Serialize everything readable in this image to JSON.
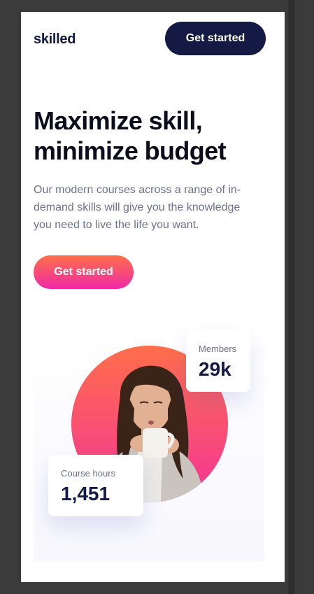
{
  "header": {
    "logo": "skilled",
    "nav_button_label": "Get started"
  },
  "hero": {
    "title": "Maximize skill, minimize budget",
    "description": "Our modern courses across a range of in-demand skills will give you the knowledge you need to live the life you want.",
    "cta_label": "Get started"
  },
  "stats": {
    "members": {
      "label": "Members",
      "value": "29k"
    },
    "course_hours": {
      "label": "Course hours",
      "value": "1,451"
    }
  },
  "colors": {
    "navy": "#141a44",
    "gradient_start": "#ff6f48",
    "gradient_end": "#f02aa6",
    "text_muted": "#6d7190"
  }
}
